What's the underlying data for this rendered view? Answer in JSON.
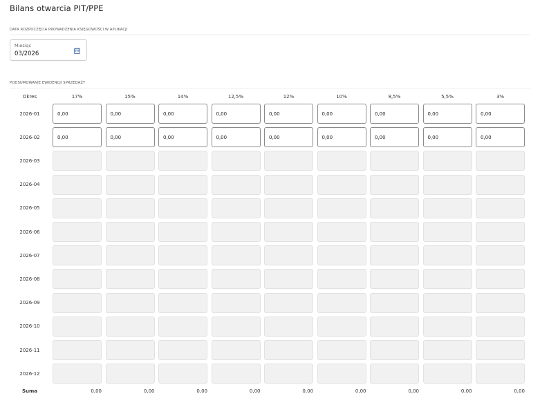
{
  "title": "Bilans otwarcia PIT/PPE",
  "start_section": {
    "label": "DATA ROZPOCZĘCIA PROWADZENIA KSIĘGOWOŚCI W APLIKACJI",
    "month_field": {
      "label": "Miesiąc",
      "value": "03/2026",
      "icon": "calendar-icon"
    }
  },
  "summary_section": {
    "label": "PODSUMOWANIE EWIDENCJI SPRZEDAŻY",
    "period_header": "Okres",
    "rate_headers": [
      "17%",
      "15%",
      "14%",
      "12,5%",
      "12%",
      "10%",
      "8,5%",
      "5,5%",
      "3%"
    ],
    "rows": [
      {
        "period": "2026-01",
        "editable": true,
        "values": [
          "0,00",
          "0,00",
          "0,00",
          "0,00",
          "0,00",
          "0,00",
          "0,00",
          "0,00",
          "0,00"
        ]
      },
      {
        "period": "2026-02",
        "editable": true,
        "values": [
          "0,00",
          "0,00",
          "0,00",
          "0,00",
          "0,00",
          "0,00",
          "0,00",
          "0,00",
          "0,00"
        ]
      },
      {
        "period": "2026-03",
        "editable": false,
        "values": [
          "",
          "",
          "",
          "",
          "",
          "",
          "",
          "",
          ""
        ]
      },
      {
        "period": "2026-04",
        "editable": false,
        "values": [
          "",
          "",
          "",
          "",
          "",
          "",
          "",
          "",
          ""
        ]
      },
      {
        "period": "2026-05",
        "editable": false,
        "values": [
          "",
          "",
          "",
          "",
          "",
          "",
          "",
          "",
          ""
        ]
      },
      {
        "period": "2026-06",
        "editable": false,
        "values": [
          "",
          "",
          "",
          "",
          "",
          "",
          "",
          "",
          ""
        ]
      },
      {
        "period": "2026-07",
        "editable": false,
        "values": [
          "",
          "",
          "",
          "",
          "",
          "",
          "",
          "",
          ""
        ]
      },
      {
        "period": "2026-08",
        "editable": false,
        "values": [
          "",
          "",
          "",
          "",
          "",
          "",
          "",
          "",
          ""
        ]
      },
      {
        "period": "2026-09",
        "editable": false,
        "values": [
          "",
          "",
          "",
          "",
          "",
          "",
          "",
          "",
          ""
        ]
      },
      {
        "period": "2026-10",
        "editable": false,
        "values": [
          "",
          "",
          "",
          "",
          "",
          "",
          "",
          "",
          ""
        ]
      },
      {
        "period": "2026-11",
        "editable": false,
        "values": [
          "",
          "",
          "",
          "",
          "",
          "",
          "",
          "",
          ""
        ]
      },
      {
        "period": "2026-12",
        "editable": false,
        "values": [
          "",
          "",
          "",
          "",
          "",
          "",
          "",
          "",
          ""
        ]
      }
    ],
    "sum_label": "Suma",
    "sums": [
      "0,00",
      "0,00",
      "0,00",
      "0,00",
      "0,00",
      "0,00",
      "0,00",
      "0,00",
      "0,00"
    ]
  }
}
